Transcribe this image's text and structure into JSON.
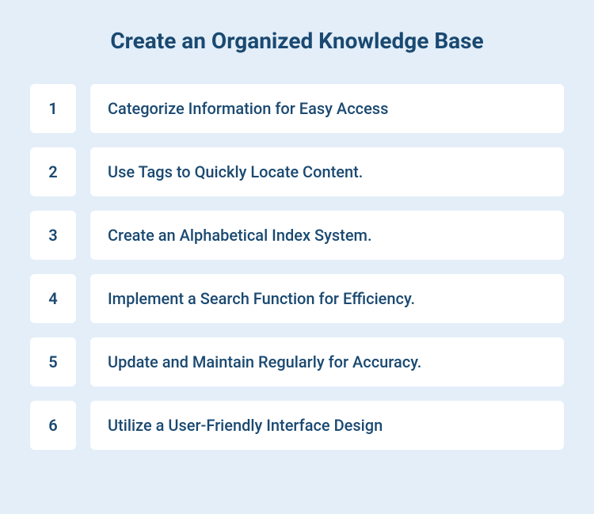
{
  "title": "Create an Organized Knowledge Base",
  "items": [
    {
      "number": "1",
      "text": "Categorize Information for Easy Access"
    },
    {
      "number": "2",
      "text": "Use Tags to Quickly Locate Content."
    },
    {
      "number": "3",
      "text": "Create an Alphabetical Index System."
    },
    {
      "number": "4",
      "text": "Implement a Search Function for Efficiency."
    },
    {
      "number": "5",
      "text": "Update and Maintain Regularly for Accuracy."
    },
    {
      "number": "6",
      "text": "Utilize a User-Friendly Interface Design"
    }
  ]
}
